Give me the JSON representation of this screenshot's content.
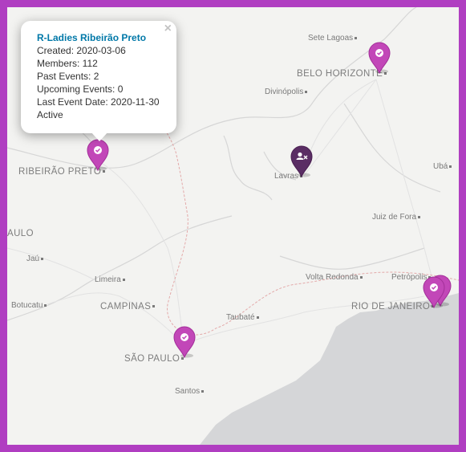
{
  "colors": {
    "frame": "#b03ec1",
    "marker_active": "#c247b8",
    "marker_inactive": "#5a2d64",
    "ocean": "#d5d6d8"
  },
  "cities": [
    {
      "name": "Sete Lagoas",
      "major": false
    },
    {
      "name": "BELO HORIZONTE",
      "major": true
    },
    {
      "name": "Divinópolis",
      "major": false
    },
    {
      "name": "RIBEIRÃO PRETO",
      "major": true
    },
    {
      "name": "Lavras",
      "major": false
    },
    {
      "name": "Ubá",
      "major": false
    },
    {
      "name": "Juiz de Fora",
      "major": false
    },
    {
      "name": "AULO",
      "major": true
    },
    {
      "name": "Jaú",
      "major": false
    },
    {
      "name": "Limeira",
      "major": false
    },
    {
      "name": "Volta Redonda",
      "major": false
    },
    {
      "name": "Petrópolis",
      "major": false
    },
    {
      "name": "Botucatu",
      "major": false
    },
    {
      "name": "CAMPINAS",
      "major": true
    },
    {
      "name": "RIO DE JANEIRO",
      "major": true
    },
    {
      "name": "Taubaté",
      "major": false
    },
    {
      "name": "SÃO PAULO",
      "major": true
    },
    {
      "name": "Santos",
      "major": false
    }
  ],
  "markers": [
    {
      "name": "Belo Horizonte",
      "status": "active",
      "icon": "check-icon"
    },
    {
      "name": "Ribeirão Preto",
      "status": "active",
      "icon": "check-icon"
    },
    {
      "name": "Lavras",
      "status": "inactive",
      "icon": "user-x-icon"
    },
    {
      "name": "São Paulo",
      "status": "active",
      "icon": "check-icon"
    },
    {
      "name": "Rio de Janeiro 1",
      "status": "active",
      "icon": "check-icon"
    },
    {
      "name": "Rio de Janeiro 2",
      "status": "active",
      "icon": "check-icon"
    }
  ],
  "popup": {
    "title": "R-Ladies Ribeirão Preto",
    "close": "×",
    "lines": [
      "Created: 2020-03-06",
      "Members: 112",
      "Past Events: 2",
      "Upcoming Events: 0",
      "Last Event Date: 2020-11-30",
      "Active"
    ]
  }
}
